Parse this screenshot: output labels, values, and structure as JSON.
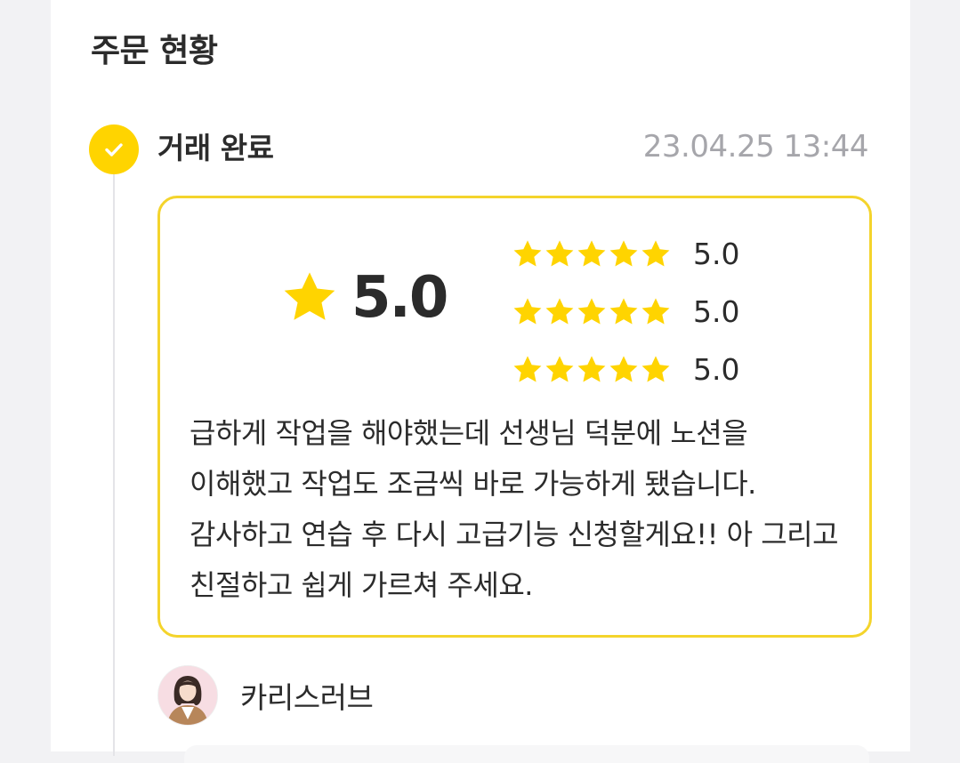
{
  "section": {
    "title": "주문 현황"
  },
  "status": {
    "label": "거래 완료",
    "time": "23.04.25 13:44",
    "accent": "#ffd400"
  },
  "review": {
    "overall_score": "5.0",
    "rows": [
      {
        "stars": 5,
        "score": "5.0"
      },
      {
        "stars": 5,
        "score": "5.0"
      },
      {
        "stars": 5,
        "score": "5.0"
      }
    ],
    "text": "급하게 작업을 해야했는데 선생님 덕분에 노션을 이해했고 작업도 조금씩 바로 가능하게 됐습니다. 감사하고 연습 후 다시 고급기능 신청할게요!! 아 그리고 친절하고 쉽게 가르쳐 주세요.",
    "star_color": "#ffd400",
    "border_color": "#f4d42c"
  },
  "reviewer": {
    "name": "카리스러브"
  },
  "icons": {
    "status": "check-icon",
    "rating": "star-icon"
  }
}
